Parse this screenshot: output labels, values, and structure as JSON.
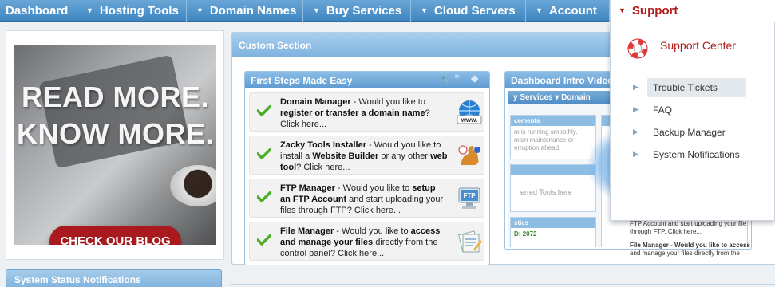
{
  "nav": {
    "dashboard": "Dashboard",
    "hosting_tools": "Hosting Tools",
    "domain_names": "Domain Names",
    "buy_services": "Buy Services",
    "cloud_servers": "Cloud Servers",
    "account": "Account",
    "support": "Support"
  },
  "promo": {
    "line1": "READ MORE.",
    "line2": "KNOW MORE.",
    "button": "CHECK OUR BLOG"
  },
  "system_status": {
    "title": "System Status Notifications"
  },
  "custom_section": {
    "title": "Custom Section"
  },
  "first_steps": {
    "title": "First Steps Made Easy",
    "items": [
      {
        "name": "Domain Manager",
        "pre": " - Would you like to ",
        "bold": "register or transfer a domain name",
        "post": "? Click here...",
        "icon": "www-globe-icon"
      },
      {
        "name": "Zacky Tools Installer",
        "pre": " - Would you like to install a ",
        "bold": "Website Builder",
        "post": " or any other ",
        "bold2": "web tool",
        "post2": "? Click here...",
        "icon": "kangaroo-icon"
      },
      {
        "name": "FTP Manager",
        "pre": " - Would you like to ",
        "bold": "setup an FTP Account",
        "post": " and start uploading your files through FTP? Click here...",
        "icon": "ftp-computer-icon"
      },
      {
        "name": "File Manager",
        "pre": " - Would you like to ",
        "bold": "access and manage your files",
        "post": " directly from the control panel? Click here...",
        "icon": "file-manager-icon"
      }
    ]
  },
  "video_widget": {
    "title": "Dashboard Intro Video",
    "mini_nav": "y Services  ▾  Domain",
    "panel1_head": "cements",
    "panel1_text": "m is running smoothly. main maintenance or erruption ahead.",
    "panel2_text": "erred Tools here",
    "panel3_head": "stics",
    "panel3_value": "D: 2072"
  },
  "support_menu": {
    "center_label": "Support Center",
    "items": [
      "Trouble Tickets",
      "FAQ",
      "Backup Manager",
      "System Notifications"
    ]
  },
  "peek": {
    "ftp_line1": "FTP Account and start uploading your file",
    "ftp_line2": "through FTP. Click here...",
    "file_line1": "File Manager - Would you like to access",
    "file_line2": "and manage your files directly from the"
  },
  "colors": {
    "nav_blue": "#4a8fc8",
    "support_red": "#b01d1d",
    "check_green": "#4caf2a"
  }
}
